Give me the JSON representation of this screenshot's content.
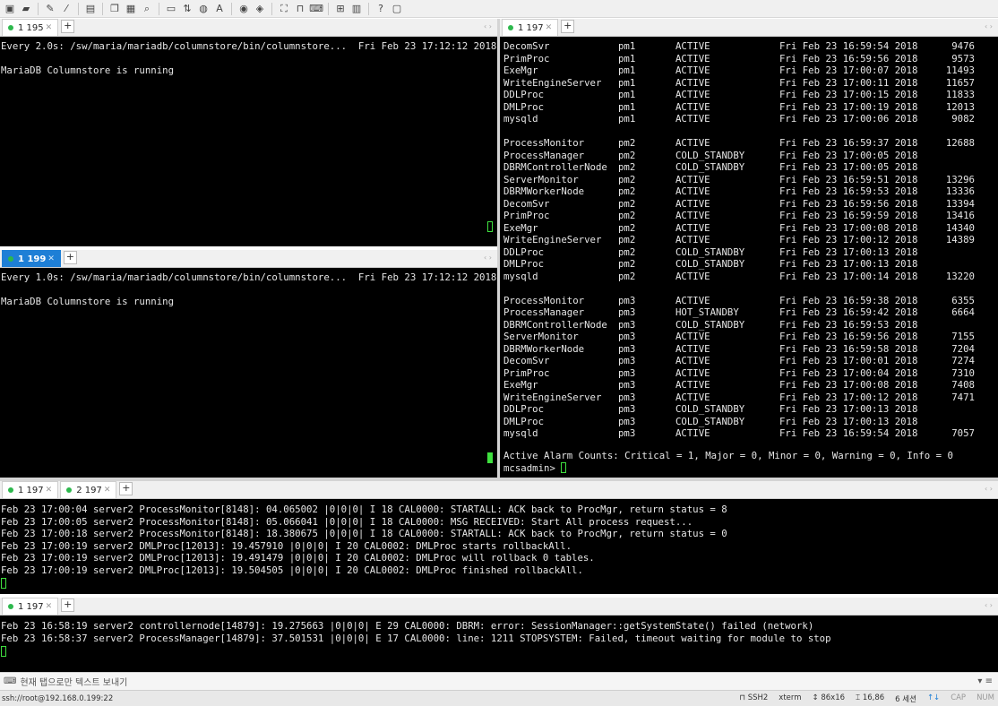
{
  "toolbar": {
    "icons": [
      "new-session-icon",
      "open-folder-icon",
      "pen-icon",
      "brush-icon",
      "new-window-icon",
      "copy-icon",
      "paste-icon",
      "find-icon",
      "print-icon",
      "transfer-icon",
      "globe-icon",
      "font-icon",
      "script-icon",
      "macro-icon",
      "fullscreen-icon",
      "lock-icon",
      "keyboard-icon",
      "plus-window-icon",
      "layout-icon",
      "help-icon",
      "chat-icon"
    ]
  },
  "panes": {
    "top_left": {
      "tabs": [
        {
          "label": "1 195",
          "active": false
        }
      ],
      "header": "Every 2.0s: /sw/maria/mariadb/columnstore/bin/columnstore...  Fri Feb 23 17:12:12 2018",
      "message": "MariaDB Columnstore is running"
    },
    "middle_left": {
      "tabs": [
        {
          "label": "1 199",
          "active": true
        }
      ],
      "header": "Every 1.0s: /sw/maria/mariadb/columnstore/bin/columnstore...  Fri Feb 23 17:12:12 2018",
      "message": "MariaDB Columnstore is running"
    },
    "right": {
      "tabs": [
        {
          "label": "1 197",
          "active": false
        }
      ],
      "rows": [
        [
          "DecomSvr",
          "pm1",
          "ACTIVE",
          "Fri Feb 23 16:59:54 2018",
          "9476"
        ],
        [
          "PrimProc",
          "pm1",
          "ACTIVE",
          "Fri Feb 23 16:59:56 2018",
          "9573"
        ],
        [
          "ExeMgr",
          "pm1",
          "ACTIVE",
          "Fri Feb 23 17:00:07 2018",
          "11493"
        ],
        [
          "WriteEngineServer",
          "pm1",
          "ACTIVE",
          "Fri Feb 23 17:00:11 2018",
          "11657"
        ],
        [
          "DDLProc",
          "pm1",
          "ACTIVE",
          "Fri Feb 23 17:00:15 2018",
          "11833"
        ],
        [
          "DMLProc",
          "pm1",
          "ACTIVE",
          "Fri Feb 23 17:00:19 2018",
          "12013"
        ],
        [
          "mysqld",
          "pm1",
          "ACTIVE",
          "Fri Feb 23 17:00:06 2018",
          "9082"
        ],
        [
          "",
          "",
          "",
          "",
          ""
        ],
        [
          "ProcessMonitor",
          "pm2",
          "ACTIVE",
          "Fri Feb 23 16:59:37 2018",
          "12688"
        ],
        [
          "ProcessManager",
          "pm2",
          "COLD_STANDBY",
          "Fri Feb 23 17:00:05 2018",
          ""
        ],
        [
          "DBRMControllerNode",
          "pm2",
          "COLD_STANDBY",
          "Fri Feb 23 17:00:05 2018",
          ""
        ],
        [
          "ServerMonitor",
          "pm2",
          "ACTIVE",
          "Fri Feb 23 16:59:51 2018",
          "13296"
        ],
        [
          "DBRMWorkerNode",
          "pm2",
          "ACTIVE",
          "Fri Feb 23 16:59:53 2018",
          "13336"
        ],
        [
          "DecomSvr",
          "pm2",
          "ACTIVE",
          "Fri Feb 23 16:59:56 2018",
          "13394"
        ],
        [
          "PrimProc",
          "pm2",
          "ACTIVE",
          "Fri Feb 23 16:59:59 2018",
          "13416"
        ],
        [
          "ExeMgr",
          "pm2",
          "ACTIVE",
          "Fri Feb 23 17:00:08 2018",
          "14340"
        ],
        [
          "WriteEngineServer",
          "pm2",
          "ACTIVE",
          "Fri Feb 23 17:00:12 2018",
          "14389"
        ],
        [
          "DDLProc",
          "pm2",
          "COLD_STANDBY",
          "Fri Feb 23 17:00:13 2018",
          ""
        ],
        [
          "DMLProc",
          "pm2",
          "COLD_STANDBY",
          "Fri Feb 23 17:00:13 2018",
          ""
        ],
        [
          "mysqld",
          "pm2",
          "ACTIVE",
          "Fri Feb 23 17:00:14 2018",
          "13220"
        ],
        [
          "",
          "",
          "",
          "",
          ""
        ],
        [
          "ProcessMonitor",
          "pm3",
          "ACTIVE",
          "Fri Feb 23 16:59:38 2018",
          "6355"
        ],
        [
          "ProcessManager",
          "pm3",
          "HOT_STANDBY",
          "Fri Feb 23 16:59:42 2018",
          "6664"
        ],
        [
          "DBRMControllerNode",
          "pm3",
          "COLD_STANDBY",
          "Fri Feb 23 16:59:53 2018",
          ""
        ],
        [
          "ServerMonitor",
          "pm3",
          "ACTIVE",
          "Fri Feb 23 16:59:56 2018",
          "7155"
        ],
        [
          "DBRMWorkerNode",
          "pm3",
          "ACTIVE",
          "Fri Feb 23 16:59:58 2018",
          "7204"
        ],
        [
          "DecomSvr",
          "pm3",
          "ACTIVE",
          "Fri Feb 23 17:00:01 2018",
          "7274"
        ],
        [
          "PrimProc",
          "pm3",
          "ACTIVE",
          "Fri Feb 23 17:00:04 2018",
          "7310"
        ],
        [
          "ExeMgr",
          "pm3",
          "ACTIVE",
          "Fri Feb 23 17:00:08 2018",
          "7408"
        ],
        [
          "WriteEngineServer",
          "pm3",
          "ACTIVE",
          "Fri Feb 23 17:00:12 2018",
          "7471"
        ],
        [
          "DDLProc",
          "pm3",
          "COLD_STANDBY",
          "Fri Feb 23 17:00:13 2018",
          ""
        ],
        [
          "DMLProc",
          "pm3",
          "COLD_STANDBY",
          "Fri Feb 23 17:00:13 2018",
          ""
        ],
        [
          "mysqld",
          "pm3",
          "ACTIVE",
          "Fri Feb 23 16:59:54 2018",
          "7057"
        ]
      ],
      "alarm_line": "Active Alarm Counts: Critical = 1, Major = 0, Minor = 0, Warning = 0, Info = 0",
      "prompt": "mcsadmin> "
    },
    "log1": {
      "tabs": [
        {
          "label": "1 197",
          "active": false
        },
        {
          "label": "2 197",
          "active": false
        }
      ],
      "lines": [
        "Feb 23 17:00:04 server2 ProcessMonitor[8148]: 04.065002 |0|0|0| I 18 CAL0000: STARTALL: ACK back to ProcMgr, return status = 8",
        "Feb 23 17:00:05 server2 ProcessMonitor[8148]: 05.066041 |0|0|0| I 18 CAL0000: MSG RECEIVED: Start All process request...",
        "Feb 23 17:00:18 server2 ProcessMonitor[8148]: 18.380675 |0|0|0| I 18 CAL0000: STARTALL: ACK back to ProcMgr, return status = 0",
        "Feb 23 17:00:19 server2 DMLProc[12013]: 19.457910 |0|0|0| I 20 CAL0002: DMLProc starts rollbackAll.",
        "Feb 23 17:00:19 server2 DMLProc[12013]: 19.491479 |0|0|0| I 20 CAL0002: DMLProc will rollback 0 tables.",
        "Feb 23 17:00:19 server2 DMLProc[12013]: 19.504505 |0|0|0| I 20 CAL0002: DMLProc finished rollbackAll."
      ]
    },
    "log2": {
      "tabs": [
        {
          "label": "1 197",
          "active": false
        }
      ],
      "lines": [
        "Feb 23 16:58:19 server2 controllernode[14879]: 19.275663 |0|0|0| E 29 CAL0000: DBRM: error: SessionManager::getSystemState() failed (network)",
        "Feb 23 16:58:37 server2 ProcessManager[14879]: 37.501531 |0|0|0| E 17 CAL0000: line: 1211 STOPSYSTEM: Failed, timeout waiting for module to stop"
      ]
    }
  },
  "input_bar": {
    "text": "현재 탭으로만 텍스트 보내기"
  },
  "status": {
    "connection": "ssh://root@192.168.0.199:22",
    "protocol": "SSH2",
    "term": "xterm",
    "size": "86x16",
    "position": "16,86",
    "sessions": "6 세션",
    "cap": "CAP",
    "num": "NUM"
  }
}
